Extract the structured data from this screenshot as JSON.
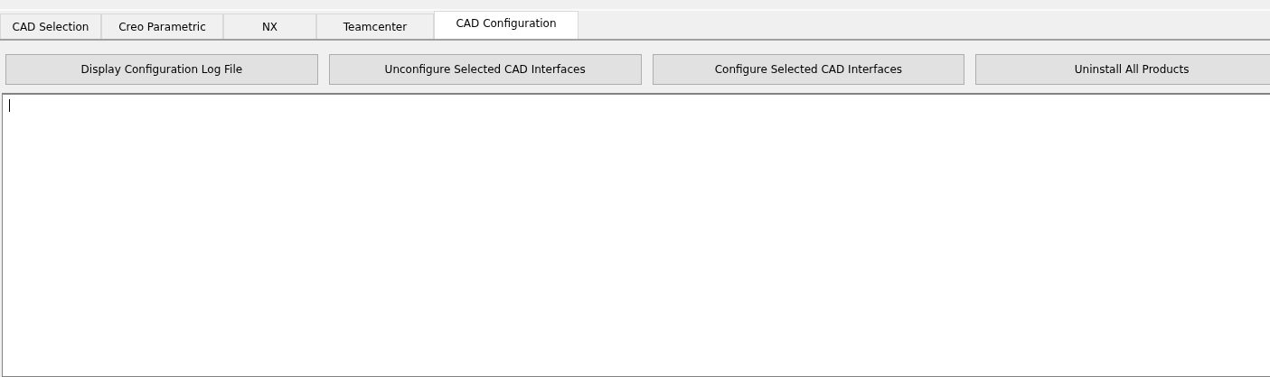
{
  "tabs": [
    {
      "label": "CAD Selection",
      "selected": false
    },
    {
      "label": "Creo Parametric",
      "selected": false
    },
    {
      "label": "NX",
      "selected": false
    },
    {
      "label": "Teamcenter",
      "selected": false
    },
    {
      "label": "CAD Configuration",
      "selected": true
    }
  ],
  "buttons": [
    "Display Configuration Log File",
    "Unconfigure Selected CAD Interfaces",
    "Configure Selected CAD Interfaces",
    "Uninstall All Products"
  ],
  "log": {
    "focused": true
  }
}
